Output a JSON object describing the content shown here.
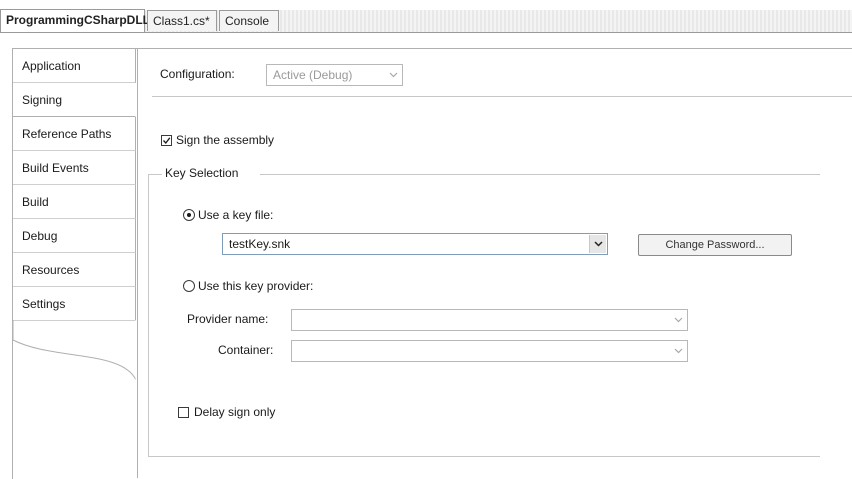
{
  "doc_tabs": [
    {
      "label": "ProgrammingCSharpDLL",
      "active": true
    },
    {
      "label": "Class1.cs*",
      "active": false
    },
    {
      "label": "Console",
      "active": false
    }
  ],
  "sidebar": {
    "items": [
      {
        "label": "Application"
      },
      {
        "label": "Signing",
        "selected": true
      },
      {
        "label": "Reference Paths"
      },
      {
        "label": "Build Events"
      },
      {
        "label": "Build"
      },
      {
        "label": "Debug"
      },
      {
        "label": "Resources"
      },
      {
        "label": "Settings"
      }
    ]
  },
  "config": {
    "label": "Configuration:",
    "value": "Active (Debug)"
  },
  "signing": {
    "sign_assembly_label": "Sign the assembly",
    "sign_assembly_checked": true,
    "key_selection_title": "Key Selection",
    "use_key_file_label": "Use a key file:",
    "use_key_file_selected": true,
    "key_file_value": "testKey.snk",
    "change_password_label": "Change Password...",
    "use_provider_label": "Use this key provider:",
    "use_provider_selected": false,
    "provider_name_label": "Provider name:",
    "provider_name_value": "",
    "container_label": "Container:",
    "container_value": "",
    "delay_sign_label": "Delay sign only",
    "delay_sign_checked": false
  },
  "icons": {
    "dropdown": "chevron-down-icon",
    "check": "checkmark-icon"
  }
}
